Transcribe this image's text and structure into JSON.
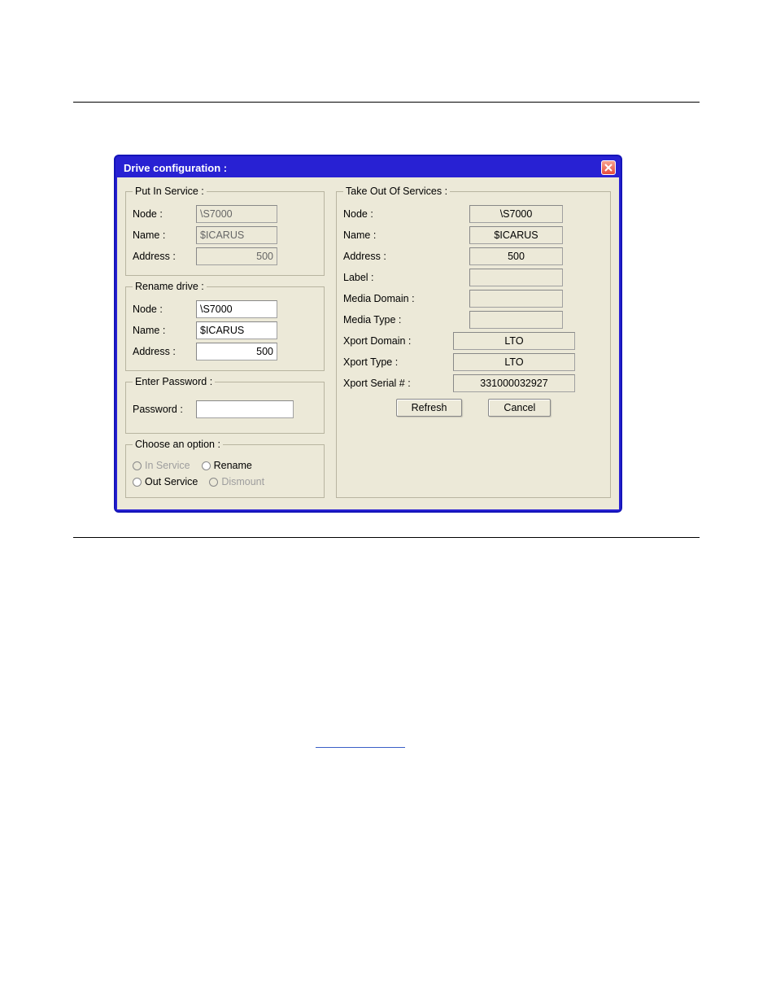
{
  "dialog": {
    "title": "Drive configuration :"
  },
  "putInService": {
    "legend": "Put In Service :",
    "nodeLabel": "Node :",
    "nodeValue": "\\S7000",
    "nameLabel": "Name :",
    "nameValue": "$ICARUS",
    "addressLabel": "Address :",
    "addressValue": "500"
  },
  "renameDrive": {
    "legend": "Rename drive :",
    "nodeLabel": "Node :",
    "nodeValue": "\\S7000",
    "nameLabel": "Name :",
    "nameValue": "$ICARUS",
    "addressLabel": "Address :",
    "addressValue": "500"
  },
  "enterPassword": {
    "legend": "Enter Password :",
    "passwordLabel": "Password :",
    "passwordValue": ""
  },
  "chooseOption": {
    "legend": "Choose an option :",
    "inService": "In Service",
    "rename": "Rename",
    "outService": "Out Service",
    "dismount": "Dismount"
  },
  "takeOut": {
    "legend": "Take Out Of Services :",
    "nodeLabel": "Node :",
    "nodeValue": "\\S7000",
    "nameLabel": "Name :",
    "nameValue": "$ICARUS",
    "addressLabel": "Address :",
    "addressValue": "500",
    "labelLabel": "Label :",
    "labelValue": "",
    "mediaDomainLabel": "Media Domain :",
    "mediaDomainValue": "",
    "mediaTypeLabel": "Media Type :",
    "mediaTypeValue": "",
    "xportDomainLabel": "Xport Domain :",
    "xportDomainValue": "LTO",
    "xportTypeLabel": "Xport Type :",
    "xportTypeValue": "LTO",
    "xportSerialLabel": "Xport Serial # :",
    "xportSerialValue": "331000032927"
  },
  "buttons": {
    "refresh": "Refresh",
    "cancel": "Cancel"
  }
}
